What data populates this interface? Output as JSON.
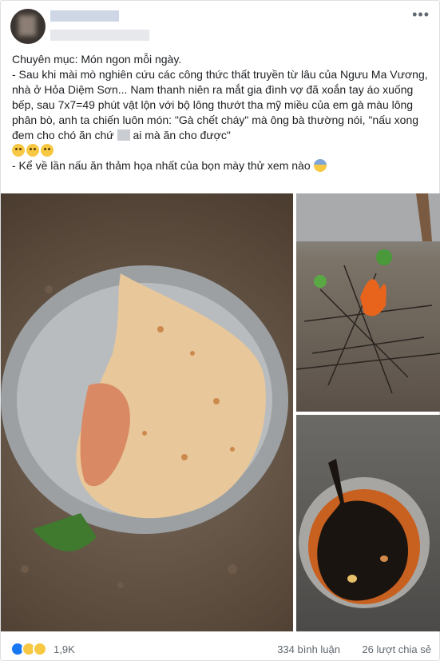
{
  "post": {
    "paragraphs": [
      "Chuyên mục: Món ngon mỗi ngày.",
      "- Sau khi mài mò nghiên cứu các công thức thất truyền từ lâu của Ngưu Ma Vương, nhà ở Hỏa Diệm Sơn... Nam thanh niên ra mắt gia đình vợ đã xoắn tay áo xuống bếp, sau 7x7=49 phút vật lộn với bộ lông thướt tha mỹ miều của em gà màu lông phân bò, anh ta chiến luôn món: \"Gà chết cháy\" mà ông bà thường nói, \"nấu xong đem cho chó ăn chứ",
      "ai mà ăn cho được\"",
      "- Kể về lần nấu ăn thảm họa nhất của bọn mày thử xem nào"
    ]
  },
  "photos": [
    {
      "icon": "photo-chicken-pot"
    },
    {
      "icon": "photo-burning-fire"
    },
    {
      "icon": "photo-burnt-chicken"
    }
  ],
  "footer": {
    "reaction_count": "1,9K",
    "comments": "334 bình luận",
    "shares": "26 lượt chia sẻ"
  },
  "colors": {
    "like": "#1877f2",
    "text": "#1c1e21",
    "meta": "#606770"
  }
}
